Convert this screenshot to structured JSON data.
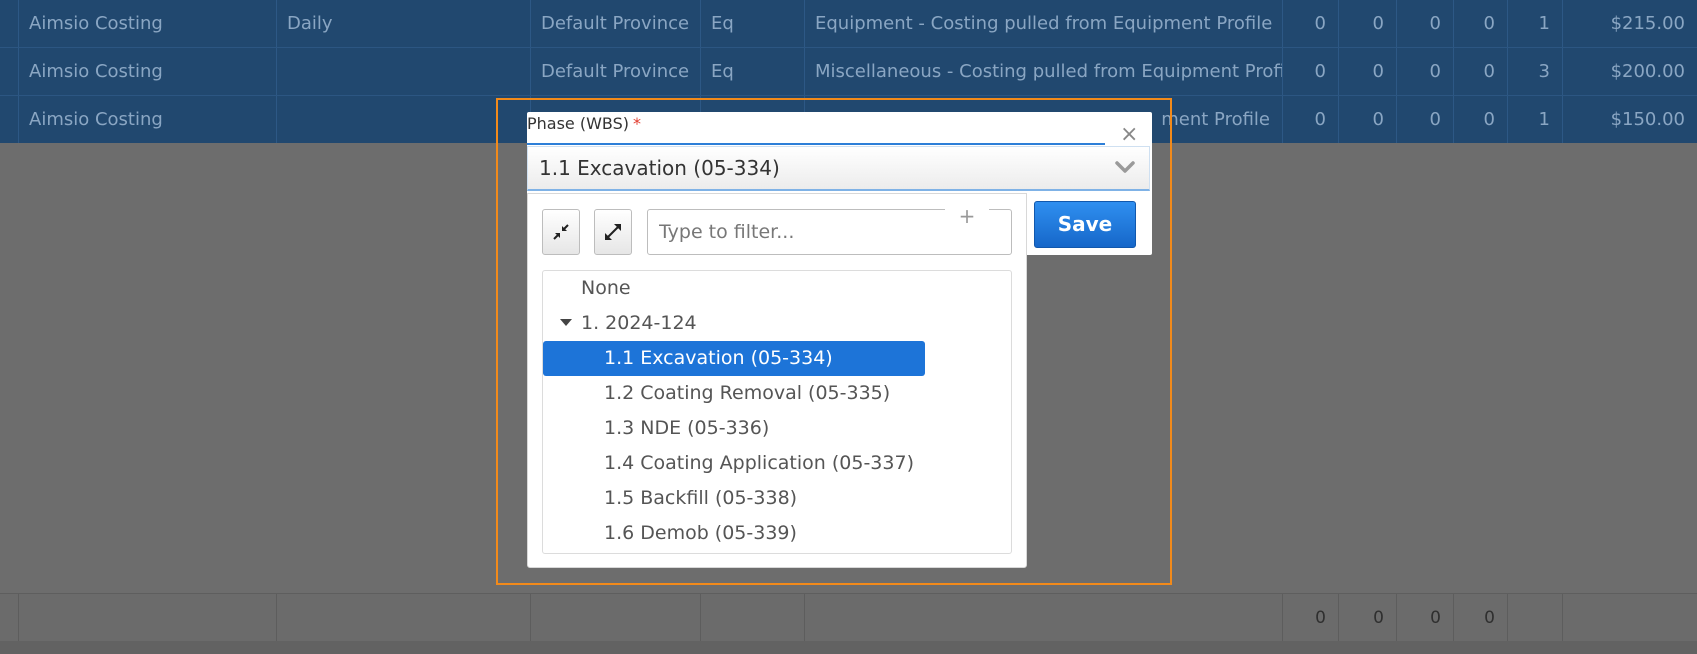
{
  "grid": {
    "rows": [
      {
        "type": "Aimsio Costing",
        "period": "Daily",
        "province": "Default Province",
        "code": "Eq",
        "description": "Equipment - Costing pulled from Equipment Profile",
        "n1": "0",
        "n2": "0",
        "n3": "0",
        "n4": "0",
        "qty": "1",
        "amount": "$215.00"
      },
      {
        "type": "Aimsio Costing",
        "period": "",
        "province": "Default Province",
        "code": "Eq",
        "description": "Miscellaneous - Costing pulled from Equipment Profile",
        "n1": "0",
        "n2": "0",
        "n3": "0",
        "n4": "0",
        "qty": "3",
        "amount": "$200.00"
      },
      {
        "type": "Aimsio Costing",
        "period": "",
        "province": "",
        "code": "",
        "description": "ment Profile",
        "n1": "0",
        "n2": "0",
        "n3": "0",
        "n4": "0",
        "qty": "1",
        "amount": "$150.00"
      }
    ],
    "totals": [
      "0",
      "0",
      "0",
      "0"
    ]
  },
  "modal": {
    "field_label": "Phase (WBS)",
    "required_mark": "*",
    "close_glyph": "×",
    "selected_value": "1.1 Excavation (05-334)",
    "save_label": "Save"
  },
  "dropdown": {
    "filter_placeholder": "Type to filter...",
    "add_glyph": "+",
    "items": [
      {
        "label": "None",
        "level": 0
      },
      {
        "label": "1. 2024-124",
        "level": 0,
        "expanded": true
      },
      {
        "label": "1.1 Excavation (05-334)",
        "level": 1,
        "selected": true
      },
      {
        "label": "1.2 Coating Removal (05-335)",
        "level": 1
      },
      {
        "label": "1.3 NDE (05-336)",
        "level": 1
      },
      {
        "label": "1.4 Coating Application (05-337)",
        "level": 1
      },
      {
        "label": "1.5 Backfill (05-338)",
        "level": 1
      },
      {
        "label": "1.6 Demob (05-339)",
        "level": 1
      }
    ]
  },
  "colors": {
    "selected_bg": "#1d74d8",
    "primary_button": "#1b74dc",
    "highlight_frame": "#f28a1a",
    "required": "#e23b2e"
  }
}
